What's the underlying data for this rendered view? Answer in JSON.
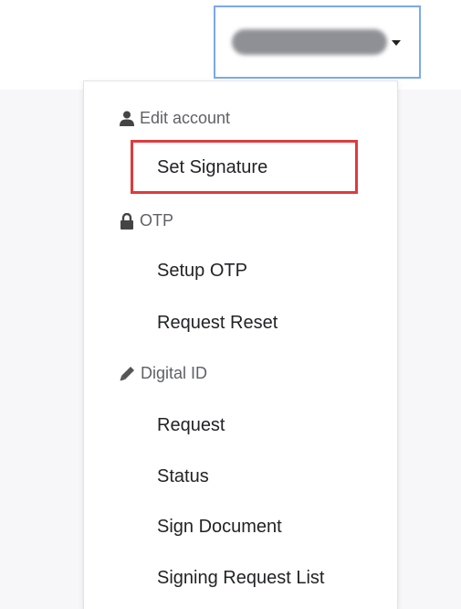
{
  "account_menu": {
    "user_name": "",
    "caret_icon": "caret-down-icon",
    "sections": [
      {
        "header": "Edit account",
        "icon": "user-icon",
        "items": [
          "Set Signature"
        ]
      },
      {
        "header": "OTP",
        "icon": "lock-icon",
        "items": [
          "Setup OTP",
          "Request Reset"
        ]
      },
      {
        "header": "Digital ID",
        "icon": "pen-icon",
        "items": [
          "Request",
          "Status",
          "Sign Document",
          "Signing Request List"
        ]
      }
    ],
    "highlighted_item": "Set Signature",
    "highlight_color": "#e03a3e",
    "focus_border_color": "#7aa9ec"
  }
}
